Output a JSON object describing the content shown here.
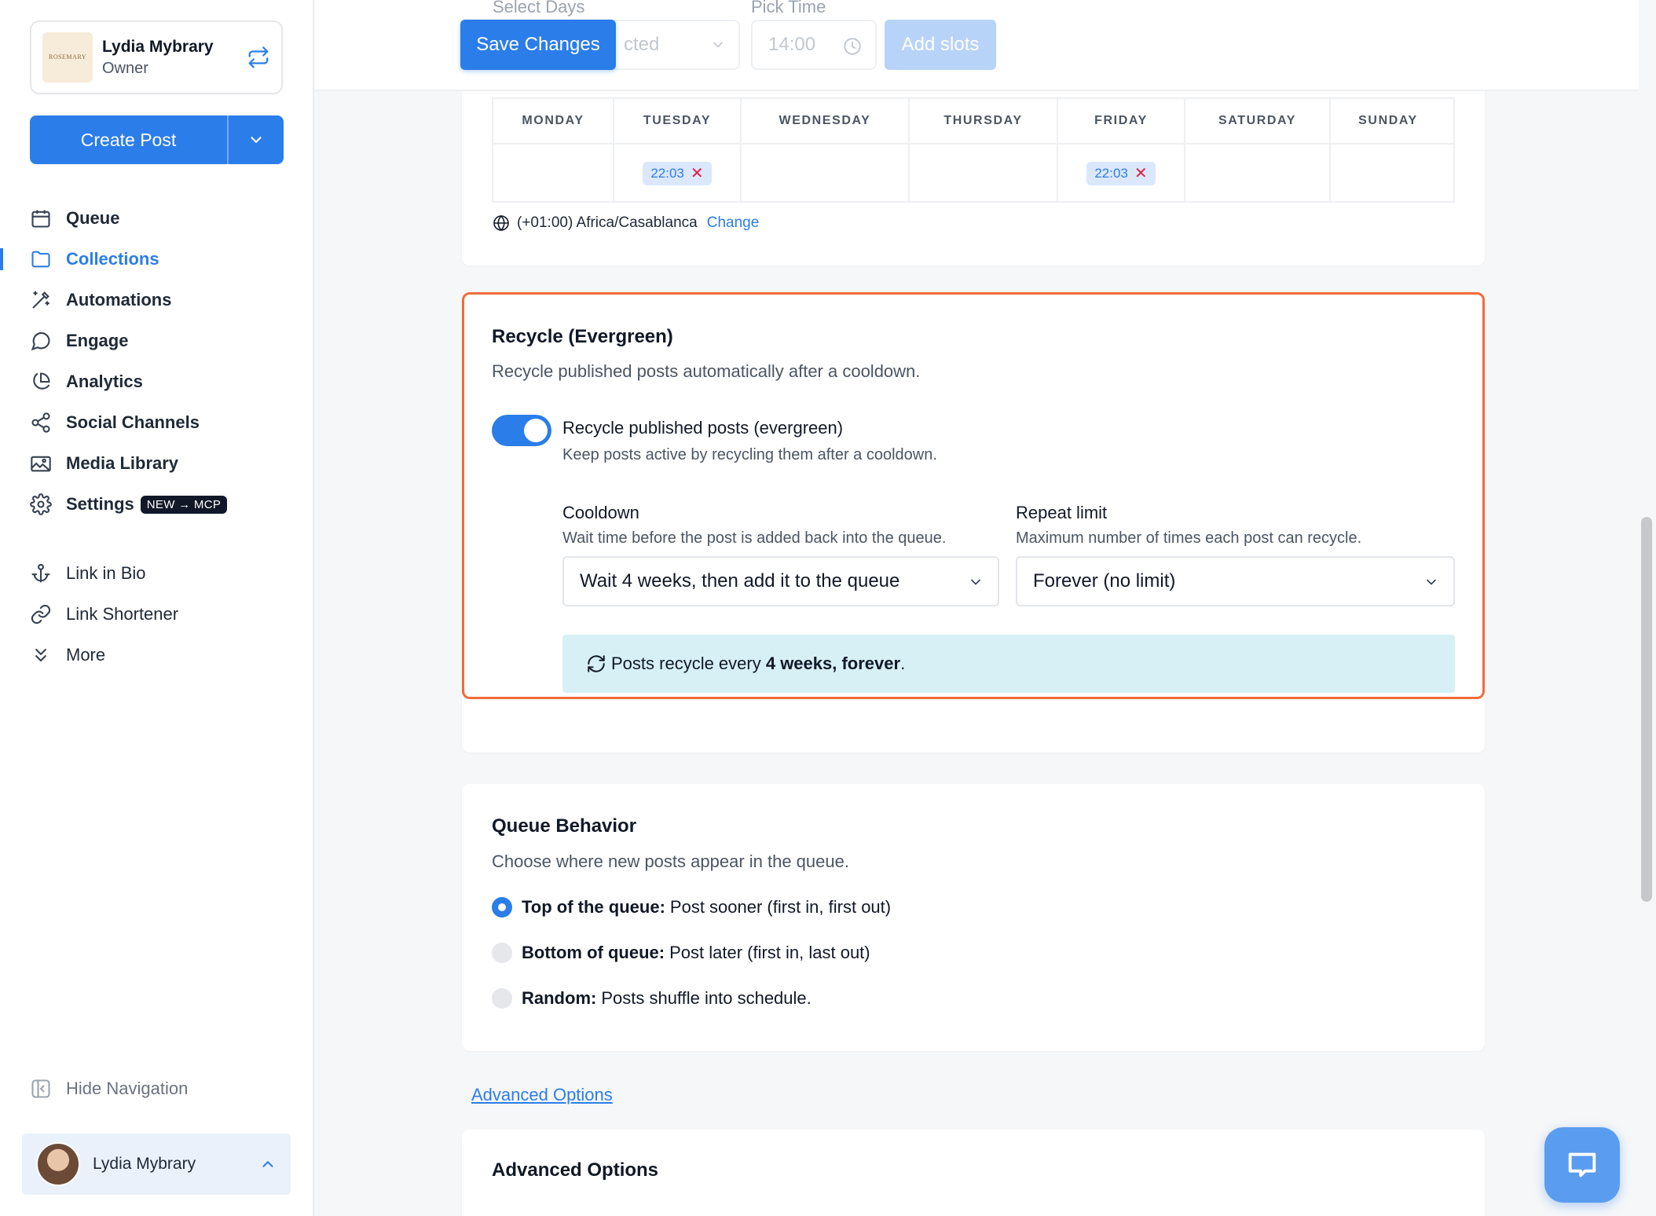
{
  "account": {
    "logo_text": "ROSEMARY",
    "name": "Lydia Mybrary",
    "role": "Owner"
  },
  "create_post": {
    "label": "Create Post"
  },
  "nav": {
    "primary": [
      {
        "label": "Queue",
        "icon": "calendar-icon"
      },
      {
        "label": "Collections",
        "icon": "folder-icon",
        "active": true
      },
      {
        "label": "Automations",
        "icon": "magic-wand-icon"
      },
      {
        "label": "Engage",
        "icon": "chat-bubble-icon"
      },
      {
        "label": "Analytics",
        "icon": "pie-chart-icon"
      },
      {
        "label": "Social Channels",
        "icon": "share-nodes-icon"
      },
      {
        "label": "Media Library",
        "icon": "images-icon"
      },
      {
        "label": "Settings",
        "icon": "gear-icon",
        "badge": "NEW → MCP"
      }
    ],
    "secondary": [
      {
        "label": "Link in Bio",
        "icon": "anchor-icon"
      },
      {
        "label": "Link Shortener",
        "icon": "link-icon"
      },
      {
        "label": "More",
        "icon": "double-chevron-down-icon"
      }
    ]
  },
  "hide_navigation": {
    "label": "Hide Navigation"
  },
  "user_footer": {
    "name": "Lydia Mybrary"
  },
  "topbar": {
    "save_changes": "Save Changes",
    "select_days_label": "Select Days",
    "select_days_value": "cted",
    "pick_time_label": "Pick Time",
    "pick_time_value": "14:00",
    "add_slots": "Add slots"
  },
  "schedule": {
    "days": [
      "MONDAY",
      "TUESDAY",
      "WEDNESDAY",
      "THURSDAY",
      "FRIDAY",
      "SATURDAY",
      "SUNDAY"
    ],
    "slots": {
      "TUESDAY": "22:03",
      "FRIDAY": "22:03"
    },
    "timezone": "(+01:00) Africa/Casablanca",
    "change_link": "Change"
  },
  "recycle": {
    "title": "Recycle (Evergreen)",
    "description": "Recycle published posts automatically after a cooldown.",
    "toggle_on": true,
    "toggle_label": "Recycle published posts (evergreen)",
    "toggle_help": "Keep posts active by recycling them after a cooldown.",
    "cooldown": {
      "label": "Cooldown",
      "help": "Wait time before the post is added back into the queue.",
      "value": "Wait 4 weeks, then add it to the queue"
    },
    "repeat_limit": {
      "label": "Repeat limit",
      "help": "Maximum number of times each post can recycle.",
      "value": "Forever (no limit)"
    },
    "summary": {
      "prefix": "Posts recycle every ",
      "bold": "4 weeks, forever",
      "suffix": "."
    }
  },
  "queue_behavior": {
    "title": "Queue Behavior",
    "description": "Choose where new posts appear in the queue.",
    "options": [
      {
        "bold": "Top of the queue:",
        "text": "Post sooner (first in, first out)",
        "checked": true
      },
      {
        "bold": "Bottom of queue:",
        "text": "Post later (first in, last out)",
        "checked": false
      },
      {
        "bold": "Random:",
        "text": "Posts shuffle into schedule.",
        "checked": false
      }
    ]
  },
  "advanced": {
    "link": "Advanced Options",
    "title": "Advanced Options"
  },
  "colors": {
    "accent": "#2b7de9",
    "highlight_border": "#f26b3a",
    "info_bg": "#d6f0f6"
  }
}
